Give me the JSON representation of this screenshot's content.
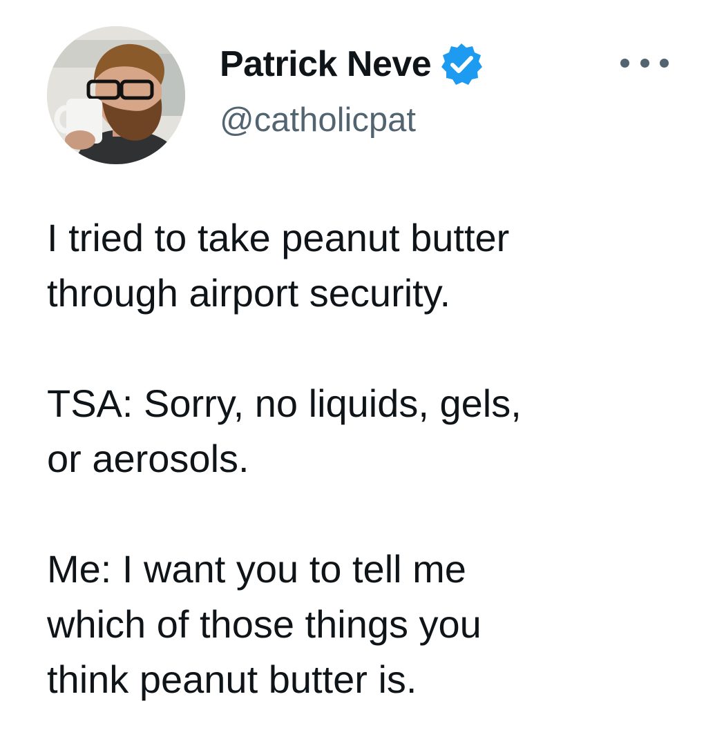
{
  "author": {
    "display_name": "Patrick Neve",
    "handle": "@catholicpat",
    "verified": true,
    "avatar_icon": "profile-photo"
  },
  "more_icon": "more-options-icon",
  "colors": {
    "name": "#0f1419",
    "handle": "#536471",
    "verified_badge": "#1d9bf0",
    "text": "#0f1419"
  },
  "tweet": {
    "paragraphs": [
      "I tried to take peanut butter\nthrough airport security.",
      "TSA: Sorry, no liquids, gels,\nor aerosols.",
      "Me: I want you to tell me\nwhich of those things you\nthink peanut butter is."
    ]
  }
}
